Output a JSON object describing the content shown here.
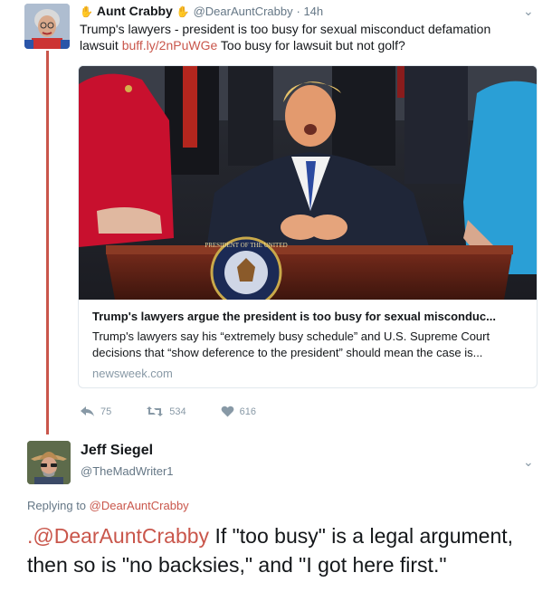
{
  "tweet1": {
    "name": "Aunt Crabby",
    "handle": "@DearAuntCrabby",
    "time": "· 14h",
    "text_part1": "Trump's lawyers - president is too busy for sexual misconduct defamation lawsuit ",
    "link": "buff.ly/2nPuWGe",
    "text_part2": " Too busy for lawsuit but not golf?",
    "card": {
      "title": "Trump's lawyers argue the president is too busy for sexual misconduc...",
      "description": "Trump's lawyers say his “extremely busy schedule” and U.S. Supreme Court decisions that “show deference to the president” should mean the case is...",
      "domain": "newsweek.com",
      "seal_text": "PRESIDENT OF THE UNITED"
    },
    "actions": {
      "replies": "75",
      "retweets": "534",
      "likes": "616"
    }
  },
  "tweet2": {
    "name": "Jeff Siegel",
    "handle": "@TheMadWriter1",
    "replying_prefix": "Replying to ",
    "replying_to": "@DearAuntCrabby",
    "mention": ".@DearAuntCrabby",
    "text": " If \"too busy\" is a legal argument, then so is \"no backsies,\" and \"I got here first.\""
  },
  "icons": {
    "reply": "reply-icon",
    "retweet": "retweet-icon",
    "like": "heart-icon",
    "chevron": "chevron-down-icon",
    "hand": "raised-hand-emoji"
  },
  "colors": {
    "link": "#c9564b",
    "thread": "#c9564b",
    "muted": "#8899a6"
  }
}
